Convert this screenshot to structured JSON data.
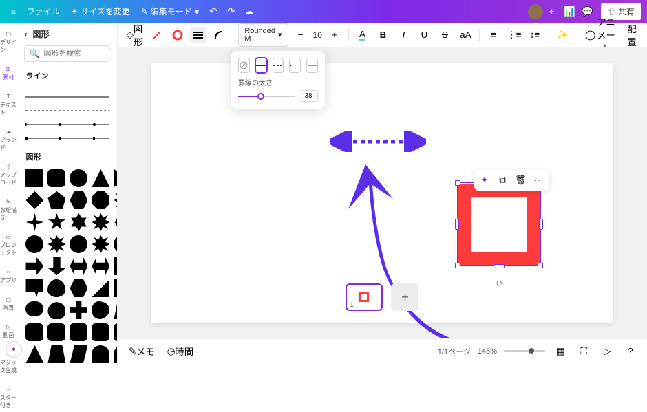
{
  "header": {
    "menu": "≡",
    "file": "ファイル",
    "resize": "サイズを変更",
    "editmode": "編集モード",
    "share": "共有"
  },
  "rail": [
    {
      "label": "デザイン",
      "icon": "□"
    },
    {
      "label": "素材",
      "icon": "⊞"
    },
    {
      "label": "テキスト",
      "icon": "T"
    },
    {
      "label": "ブランド",
      "icon": "☁"
    },
    {
      "label": "アップロード",
      "icon": "⇧"
    },
    {
      "label": "お絵描き",
      "icon": "✎"
    },
    {
      "label": "プロジェクト",
      "icon": "▭"
    },
    {
      "label": "アプリ",
      "icon": "▫▫"
    },
    {
      "label": "写真",
      "icon": "▢"
    },
    {
      "label": "動画",
      "icon": "▷"
    },
    {
      "label": "マジック生成",
      "icon": "✦"
    },
    {
      "label": "スター付き",
      "icon": "☆"
    }
  ],
  "panel": {
    "title": "図形",
    "search_placeholder": "図形を検索",
    "section_line": "ライン",
    "section_shapes": "図形"
  },
  "toolbar": {
    "shape_btn": "図形",
    "font": "Rounded M+",
    "fontsize": "10",
    "animate": "アニメート",
    "position": "配置"
  },
  "popover": {
    "label": "罫線の太さ",
    "value": "38"
  },
  "thumbs": {
    "page": "1"
  },
  "bottom": {
    "memo": "メモ",
    "time": "時間",
    "pages": "1/1ページ",
    "zoom": "145%"
  }
}
